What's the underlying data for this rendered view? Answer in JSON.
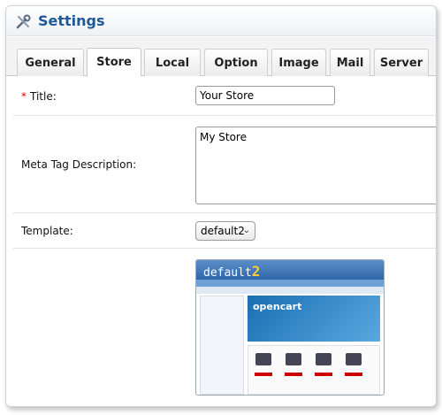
{
  "header": {
    "title": "Settings",
    "icon": "tools-icon"
  },
  "tabs": [
    {
      "label": "General",
      "active": false
    },
    {
      "label": "Store",
      "active": true
    },
    {
      "label": "Local",
      "active": false
    },
    {
      "label": "Option",
      "active": false
    },
    {
      "label": "Image",
      "active": false
    },
    {
      "label": "Mail",
      "active": false
    },
    {
      "label": "Server",
      "active": false
    }
  ],
  "form": {
    "title": {
      "required": "*",
      "label": "Title:",
      "value": "Your Store"
    },
    "meta": {
      "label": "Meta Tag Description:",
      "value": "My Store"
    },
    "template": {
      "label": "Template:",
      "value": "default2"
    },
    "preview": {
      "logo_text": "default",
      "logo_mark": "2",
      "banner_text": "opencart"
    }
  },
  "colors": {
    "title": "#1e5a9a",
    "required": "#dd0000",
    "accent": "#2f66a8"
  }
}
